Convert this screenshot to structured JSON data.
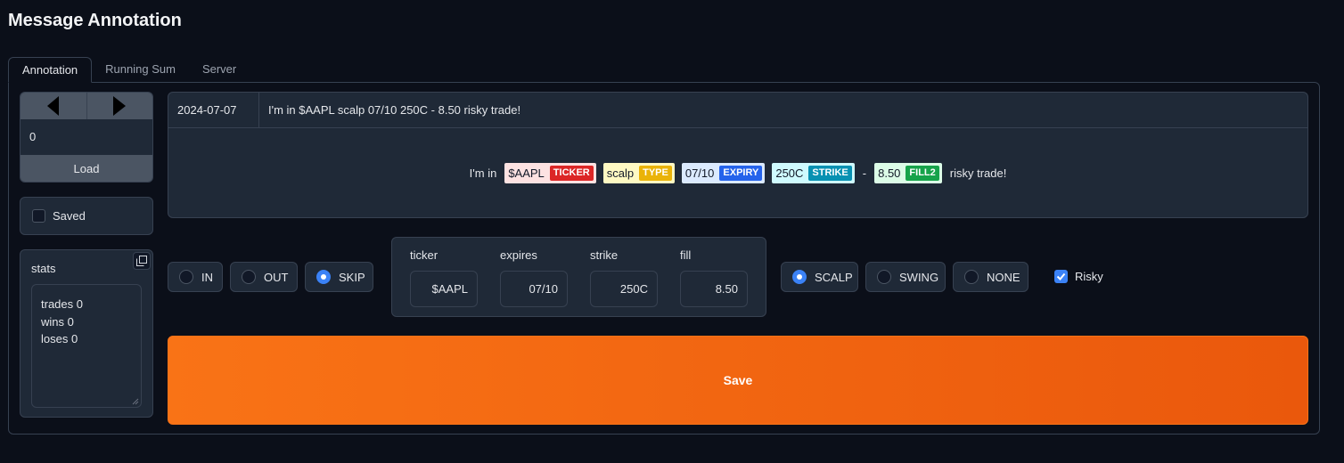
{
  "app": {
    "title": "Message Annotation"
  },
  "tabs": [
    {
      "label": "Annotation",
      "active": true
    },
    {
      "label": "Running Sum",
      "active": false
    },
    {
      "label": "Server",
      "active": false
    }
  ],
  "navigator": {
    "index_value": "0",
    "load_label": "Load"
  },
  "saved": {
    "label": "Saved",
    "checked": false
  },
  "stats": {
    "label": "stats",
    "lines": [
      "trades 0",
      "wins 0",
      "loses 0"
    ]
  },
  "message": {
    "date": "2024-07-07",
    "text": "I'm in $AAPL scalp 07/10 250C - 8.50 risky trade!",
    "highlight": [
      {
        "text": "I'm in",
        "entity": null
      },
      {
        "text": "$AAPL",
        "entity": "TICKER",
        "bg": "#fde2e2",
        "tag_color": "#dc2626"
      },
      {
        "text": "scalp",
        "entity": "TYPE",
        "bg": "#fef9c3",
        "tag_color": "#eab308"
      },
      {
        "text": "07/10",
        "entity": "EXPIRY",
        "bg": "#dbeafe",
        "tag_color": "#2563eb"
      },
      {
        "text": "250C",
        "entity": "STRIKE",
        "bg": "#cffafe",
        "tag_color": "#0891b2"
      },
      {
        "text": "-",
        "entity": null
      },
      {
        "text": "8.50",
        "entity": "FILL2",
        "bg": "#dcfce7",
        "tag_color": "#16a34a"
      },
      {
        "text": "risky trade!",
        "entity": null
      }
    ]
  },
  "direction": {
    "options": [
      {
        "label": "IN",
        "selected": false
      },
      {
        "label": "OUT",
        "selected": false
      },
      {
        "label": "SKIP",
        "selected": true
      }
    ]
  },
  "fields": {
    "ticker": {
      "label": "ticker",
      "value": "$AAPL"
    },
    "expires": {
      "label": "expires",
      "value": "07/10"
    },
    "strike": {
      "label": "strike",
      "value": "250C"
    },
    "fill": {
      "label": "fill",
      "value": "8.50"
    }
  },
  "trade_type": {
    "options": [
      {
        "label": "SCALP",
        "selected": true
      },
      {
        "label": "SWING",
        "selected": false
      },
      {
        "label": "NONE",
        "selected": false
      }
    ]
  },
  "risky": {
    "label": "Risky",
    "checked": true
  },
  "save": {
    "label": "Save"
  },
  "colors": {
    "accent": "#f97316",
    "radio_on": "#3b82f6",
    "background": "#0b0f19",
    "surface": "#1f2937"
  }
}
